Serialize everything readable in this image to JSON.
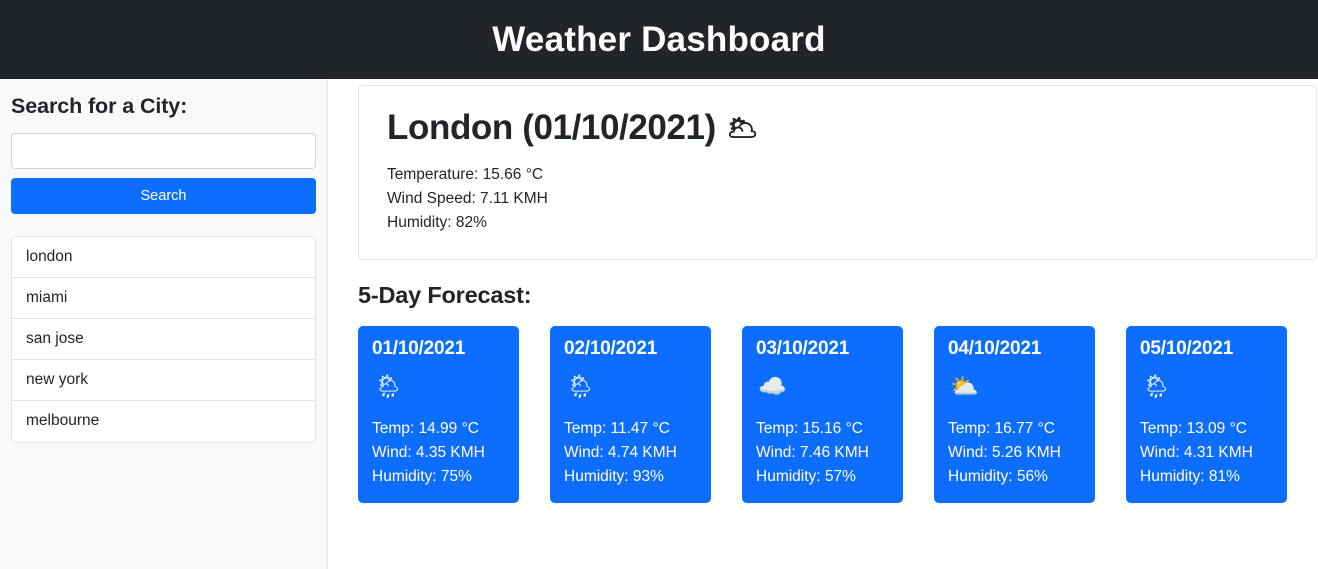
{
  "header": {
    "title": "Weather Dashboard"
  },
  "sidebar": {
    "heading": "Search for a City:",
    "search_input_value": "",
    "search_input_placeholder": "",
    "search_button_label": "Search",
    "cities": [
      {
        "name": "london"
      },
      {
        "name": "miami"
      },
      {
        "name": "san jose"
      },
      {
        "name": "new york"
      },
      {
        "name": "melbourne"
      }
    ]
  },
  "current_weather": {
    "city": "London",
    "date": "01/10/2021",
    "title": "London (01/10/2021)",
    "icon": "broken-clouds-icon",
    "icon_glyph": "🌥",
    "temperature": "Temperature: 15.66 °C",
    "wind_speed": "Wind Speed: 7.11 KMH",
    "humidity": "Humidity: 82%"
  },
  "forecast": {
    "heading": "5-Day Forecast:",
    "days": [
      {
        "date": "01/10/2021",
        "icon": "rain-with-sun-icon",
        "icon_glyph": "🌦",
        "temp": "Temp: 14.99 °C",
        "wind": "Wind: 4.35 KMH",
        "humidity": "Humidity: 75%"
      },
      {
        "date": "02/10/2021",
        "icon": "rain-with-sun-icon",
        "icon_glyph": "🌦",
        "temp": "Temp: 11.47 °C",
        "wind": "Wind: 4.74 KMH",
        "humidity": "Humidity: 93%"
      },
      {
        "date": "03/10/2021",
        "icon": "cloud-icon",
        "icon_glyph": "☁️",
        "temp": "Temp: 15.16 °C",
        "wind": "Wind: 7.46 KMH",
        "humidity": "Humidity: 57%"
      },
      {
        "date": "04/10/2021",
        "icon": "sun-behind-cloud-icon",
        "icon_glyph": "⛅",
        "temp": "Temp: 16.77 °C",
        "wind": "Wind: 5.26 KMH",
        "humidity": "Humidity: 56%"
      },
      {
        "date": "05/10/2021",
        "icon": "rain-with-sun-icon",
        "icon_glyph": "🌦",
        "temp": "Temp: 13.09 °C",
        "wind": "Wind: 4.31 KMH",
        "humidity": "Humidity: 81%"
      }
    ]
  },
  "colors": {
    "header_background": "#212529",
    "accent_blue": "#0d6efd",
    "sidebar_background": "#f8f9fa",
    "text_primary": "#212529",
    "border": "#dee2e6"
  }
}
